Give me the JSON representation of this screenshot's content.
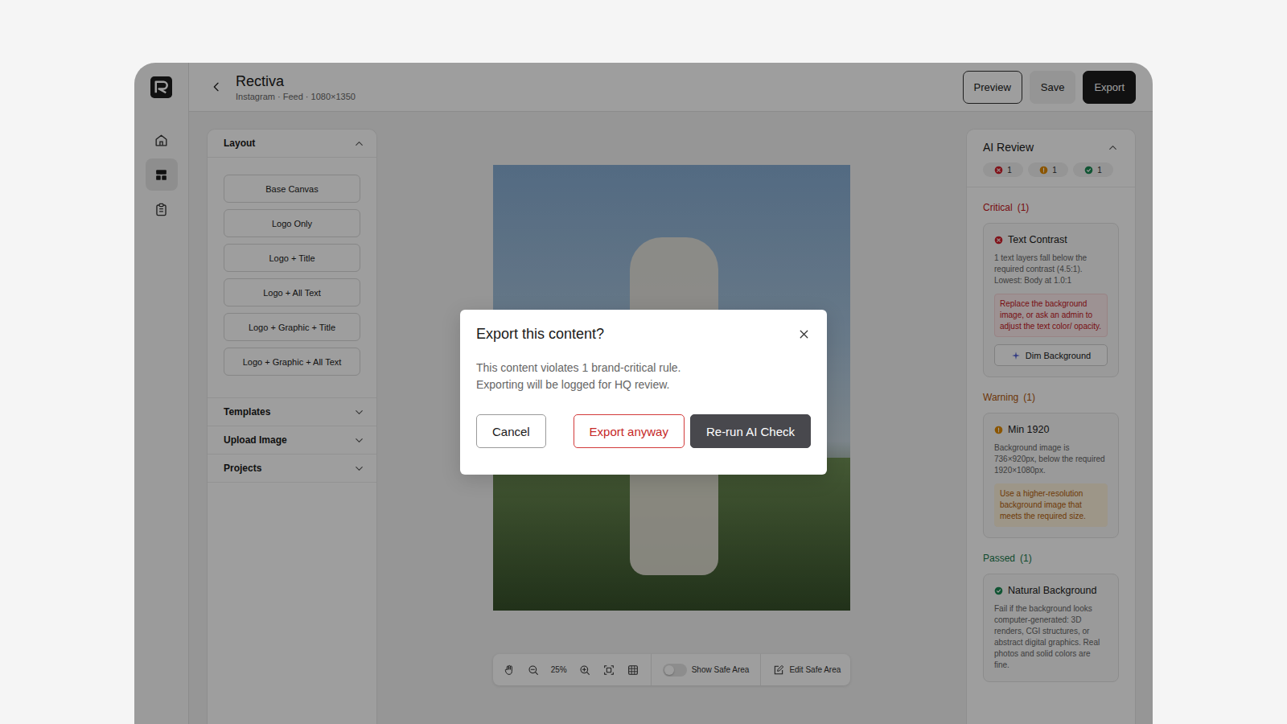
{
  "nav": [
    {
      "kind": "home",
      "selected": false
    },
    {
      "kind": "layout",
      "selected": true
    },
    {
      "kind": "clipboard",
      "selected": false
    }
  ],
  "header": {
    "title": "Rectiva",
    "subtitle": "Instagram · Feed · 1080×1350"
  },
  "actions": [
    {
      "label": "Preview",
      "kind": "outline"
    },
    {
      "label": "Save",
      "kind": "ghost"
    },
    {
      "label": "Export",
      "kind": "primary"
    }
  ],
  "left_panel": {
    "sections": [
      {
        "title": "Layout",
        "expanded": true,
        "items": [
          "Base Canvas",
          "Logo Only",
          "Logo + Title",
          "Logo + All Text",
          "Logo + Graphic + Title",
          "Logo + Graphic + All Text"
        ]
      },
      {
        "title": "Templates",
        "expanded": false,
        "items": []
      },
      {
        "title": "Upload Image",
        "expanded": false,
        "items": []
      },
      {
        "title": "Projects",
        "expanded": false,
        "items": []
      }
    ]
  },
  "canvas_toolbar": {
    "zoom": "25%",
    "safe_area_label": "Show Safe Area",
    "safe_area_on": false,
    "edit_label": "Edit Safe Area"
  },
  "review": {
    "title": "AI Review",
    "expanded": true,
    "counts": [
      {
        "kind": "critical",
        "count": "1",
        "color": "#d11f2a"
      },
      {
        "kind": "warning",
        "count": "1",
        "color": "#e08a00"
      },
      {
        "kind": "passed",
        "count": "1",
        "color": "#1c8a55"
      }
    ],
    "groups": [
      {
        "kind": "critical",
        "label": "Critical",
        "count": "(1)",
        "color": "#c4161c",
        "checks": [
          {
            "title": "Text Contrast",
            "description": "1 text layers fall below the required contrast (4.5:1). Lowest: Body at 1.0:1",
            "suggestion": "Replace the background image, or ask an admin to adjust the text color/ opacity.",
            "action": "Dim Background"
          }
        ]
      },
      {
        "kind": "warning",
        "label": "Warning",
        "count": "(1)",
        "color": "#b0560a",
        "checks": [
          {
            "title": "Min 1920",
            "description": "Background image is 736×920px, below the required 1920×1080px.",
            "suggestion": "Use a higher-resolution background image that meets the required size.",
            "action": ""
          }
        ]
      },
      {
        "kind": "passed",
        "label": "Passed",
        "count": "(1)",
        "color": "#16794a",
        "checks": [
          {
            "title": "Natural Background",
            "description": "Fail if the background looks computer-generated: 3D renders, CGI structures, or abstract digital graphics. Real photos and solid colors are fine.",
            "suggestion": "",
            "action": ""
          }
        ]
      }
    ]
  },
  "modal": {
    "title": "Export this content?",
    "message": [
      "This content violates 1 brand-critical rule.",
      "Exporting will be logged for HQ review."
    ],
    "buttons": [
      {
        "label": "Cancel",
        "kind": "secondary"
      },
      {
        "label": "Export anyway",
        "kind": "danger"
      },
      {
        "label": "Re-run AI Check",
        "kind": "primary"
      }
    ]
  }
}
